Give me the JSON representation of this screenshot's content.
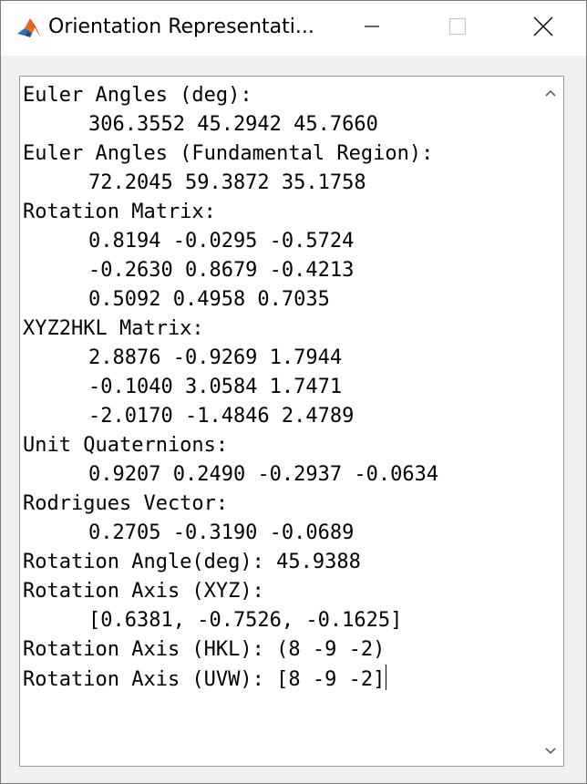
{
  "window": {
    "title": "Orientation Representati..."
  },
  "icons": {
    "app": "matlab-logo-icon",
    "minimize": "minimize-icon",
    "maximize": "maximize-icon",
    "close": "close-icon",
    "scroll_up": "chevron-up-icon",
    "scroll_down": "chevron-down-icon"
  },
  "lines": [
    {
      "text": "Euler Angles (deg):",
      "indent": false
    },
    {
      "text": "306.3552 45.2942 45.7660",
      "indent": true
    },
    {
      "text": "Euler Angles (Fundamental Region):",
      "indent": false
    },
    {
      "text": "72.2045 59.3872 35.1758",
      "indent": true
    },
    {
      "text": "Rotation Matrix:",
      "indent": false
    },
    {
      "text": "0.8194 -0.0295 -0.5724",
      "indent": true
    },
    {
      "text": "-0.2630 0.8679 -0.4213",
      "indent": true
    },
    {
      "text": "0.5092 0.4958 0.7035",
      "indent": true
    },
    {
      "text": "XYZ2HKL Matrix:",
      "indent": false
    },
    {
      "text": "2.8876 -0.9269 1.7944",
      "indent": true
    },
    {
      "text": "-0.1040 3.0584 1.7471",
      "indent": true
    },
    {
      "text": "-2.0170 -1.4846 2.4789",
      "indent": true
    },
    {
      "text": "Unit Quaternions:",
      "indent": false
    },
    {
      "text": "0.9207 0.2490 -0.2937 -0.0634",
      "indent": true
    },
    {
      "text": "Rodrigues Vector:",
      "indent": false
    },
    {
      "text": "0.2705 -0.3190 -0.0689",
      "indent": true
    },
    {
      "text": "Rotation Angle(deg): 45.9388",
      "indent": false
    },
    {
      "text": "Rotation Axis (XYZ):",
      "indent": false
    },
    {
      "text": "[0.6381, -0.7526, -0.1625]",
      "indent": true
    },
    {
      "text": "Rotation Axis (HKL): (8 -9 -2)",
      "indent": false
    },
    {
      "text": "Rotation Axis (UVW): [8 -9 -2]",
      "indent": false
    }
  ],
  "colors": {
    "titlebar_bg": "#ffffff",
    "window_bg": "#f0f0f0",
    "text": "#000000",
    "control_glyph": "#000000",
    "disabled_glyph": "#c8c8c8",
    "scroll_arrow": "#606060"
  }
}
